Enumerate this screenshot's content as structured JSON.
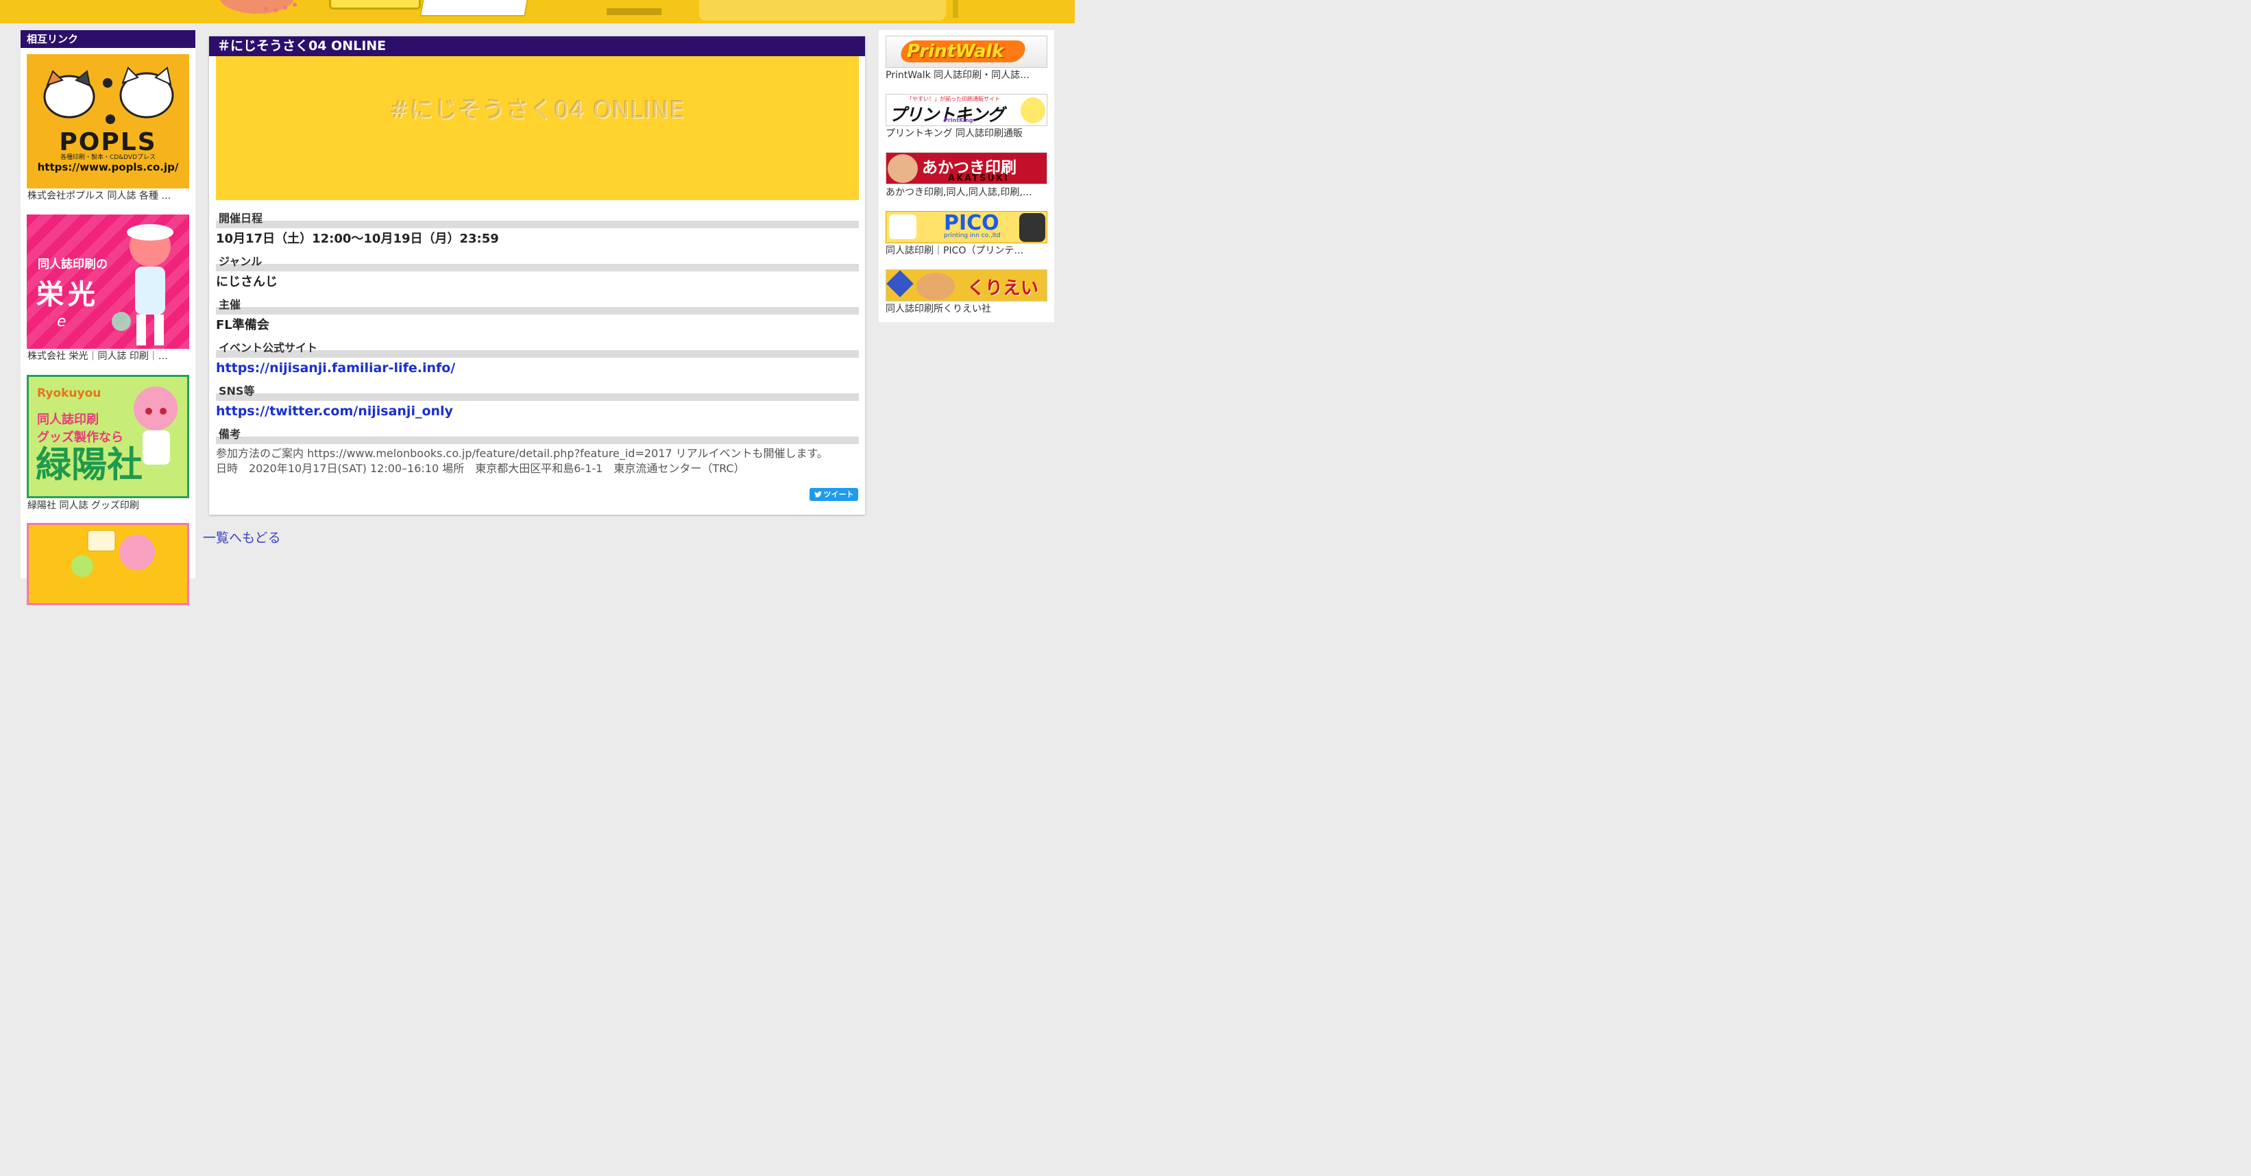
{
  "left_sidebar": {
    "title": "相互リンク",
    "items": [
      {
        "brand": "POPLS",
        "brand_sub": "各種印刷・製本・CD&DVDプレス",
        "brand_url": "https://www.popls.co.jp/",
        "caption": "株式会社ポプルス 同人誌 各種 …"
      },
      {
        "brand_line1": "同人誌印刷の",
        "brand_line2": "栄光",
        "brand_logo": "eikou",
        "caption": "株式会社 栄光｜同人誌 印刷｜…"
      },
      {
        "brand_en": "Ryokuyou",
        "brand_line1": "同人誌印刷",
        "brand_line2": "グッズ製作なら",
        "brand_line3": "緑陽社",
        "caption": "緑陽社 同人誌 グッズ印刷"
      },
      {
        "caption": ""
      }
    ]
  },
  "event": {
    "title": "＃にじそうさく04 ONLINE",
    "hero_text": "#にじそうさく04 ONLINE",
    "fields": {
      "date_label": "開催日程",
      "date_value": "10月17日（土）12:00〜10月19日（月）23:59",
      "genre_label": "ジャンル",
      "genre_value": "にじさんじ",
      "organizer_label": "主催",
      "organizer_value": "FL準備会",
      "site_label": "イベント公式サイト",
      "site_value": "https://nijisanji.familiar-life.info/",
      "sns_label": "SNS等",
      "sns_value": "https://twitter.com/nijisanji_only",
      "notes_label": "備考",
      "notes_line1": "参加方法のご案内 https://www.melonbooks.co.jp/feature/detail.php?feature_id=2017 リアルイベントも開催します。",
      "notes_line2": "日時　2020年10月17日(SAT) 12:00–16:10 場所　東京都大田区平和島6-1-1　東京流通センター（TRC）"
    },
    "tweet_label": "ツイート"
  },
  "back_link": "一覧へもどる",
  "right_sidebar": {
    "items": [
      {
        "brand": "PrintWalk",
        "caption": "PrintWalk 同人誌印刷・同人誌…"
      },
      {
        "brand_top": "「やすい！」が揃った印刷通販サイト",
        "brand": "プリントキング",
        "brand_en": "PrintKing",
        "caption": "プリントキング 同人誌印刷通販"
      },
      {
        "brand": "あかつき印刷",
        "brand_en": "AKATSUKI",
        "caption": "あかつき印刷,同人,同人誌,印刷,…"
      },
      {
        "brand": "PICO",
        "brand_sub": "printing inn co.,ltd",
        "caption": "同人誌印刷｜PICO（プリンテ…"
      },
      {
        "brand": "くりえい社",
        "caption": "同人誌印刷所くりえい社"
      }
    ]
  },
  "colors": {
    "header_purple": "#2d0f6b",
    "hero_yellow": "#ffd22e",
    "link_blue": "#1a2fcf",
    "tweet_blue": "#1d9bf0",
    "topbar_yellow": "#f5c518"
  }
}
